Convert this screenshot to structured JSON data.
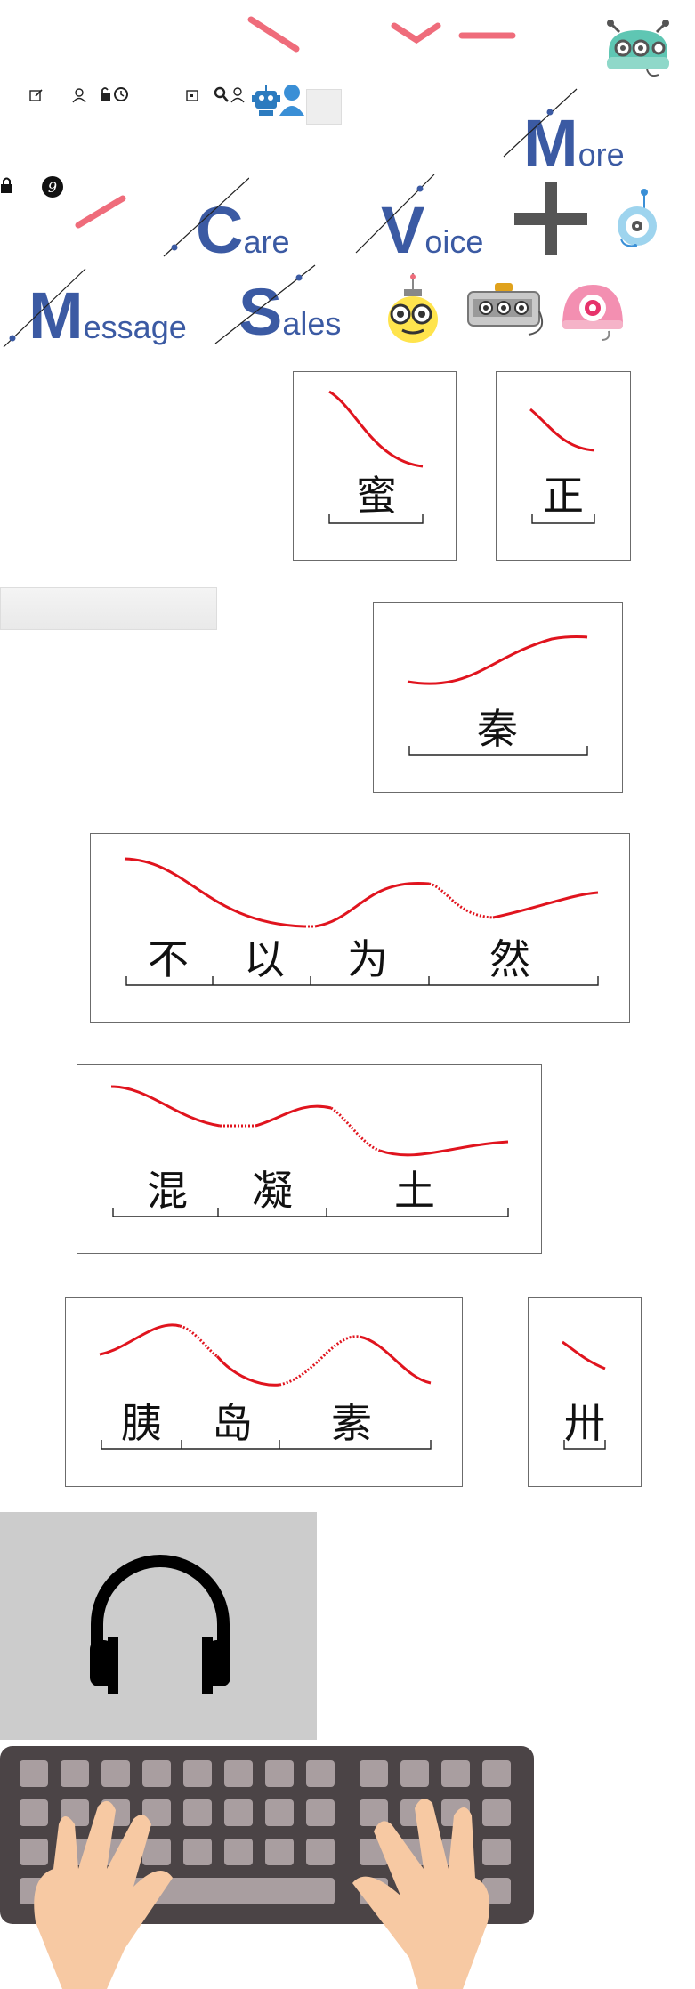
{
  "palette": {
    "accent": "#3b5aa3",
    "tone_curve": "#e0141e",
    "pink": "#ef6c7b",
    "keyboard": "#4b4446",
    "key": "#a99ea0",
    "hands": "#f7c9a3",
    "headphone_bg": "#cccccc"
  },
  "top_icons": [
    "edit-icon",
    "user-icon",
    "lock-clock-icon",
    "calendar-icon",
    "search-icon",
    "user-icon",
    "robot-icon",
    "person-icon"
  ],
  "side_icons": [
    "lock-icon",
    "music-icon"
  ],
  "menu_words": [
    {
      "initial": "M",
      "rest": "ore"
    },
    {
      "initial": "C",
      "rest": "are"
    },
    {
      "initial": "V",
      "rest": "oice"
    },
    {
      "initial": "M",
      "rest": "essage"
    },
    {
      "initial": "S",
      "rest": "ales"
    }
  ],
  "plus_label": "+",
  "cards": [
    {
      "chars": [
        "蜜"
      ]
    },
    {
      "chars": [
        "正"
      ]
    },
    {
      "chars": [
        "秦"
      ]
    },
    {
      "chars": [
        "不",
        "以",
        "为",
        "然"
      ]
    },
    {
      "chars": [
        "混",
        "凝",
        "土"
      ]
    },
    {
      "chars": [
        "胰",
        "岛",
        "素"
      ]
    },
    {
      "chars": [
        "卅"
      ]
    }
  ],
  "illustrations": [
    "headphones-icon",
    "keyboard-with-hands"
  ]
}
